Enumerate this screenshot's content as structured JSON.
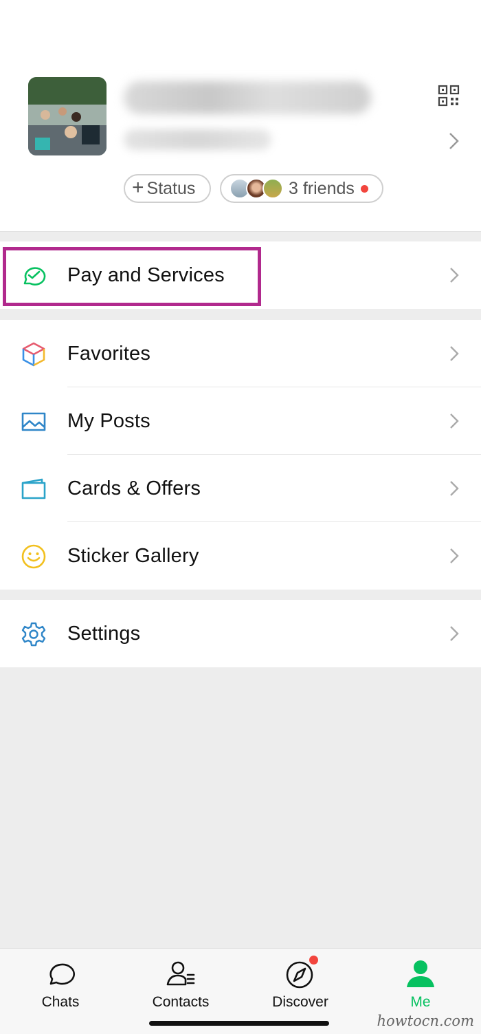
{
  "profile": {
    "status_label": "Status",
    "friends_label": "3 friends"
  },
  "menu": {
    "pay": "Pay and Services",
    "favorites": "Favorites",
    "posts": "My Posts",
    "cards": "Cards & Offers",
    "stickers": "Sticker Gallery",
    "settings": "Settings"
  },
  "tabs": {
    "chats": "Chats",
    "contacts": "Contacts",
    "discover": "Discover",
    "me": "Me"
  },
  "colors": {
    "accent_green": "#07c160",
    "highlight_magenta": "#b1298d",
    "badge_red": "#f2453d"
  },
  "watermark": "howtocn.com"
}
